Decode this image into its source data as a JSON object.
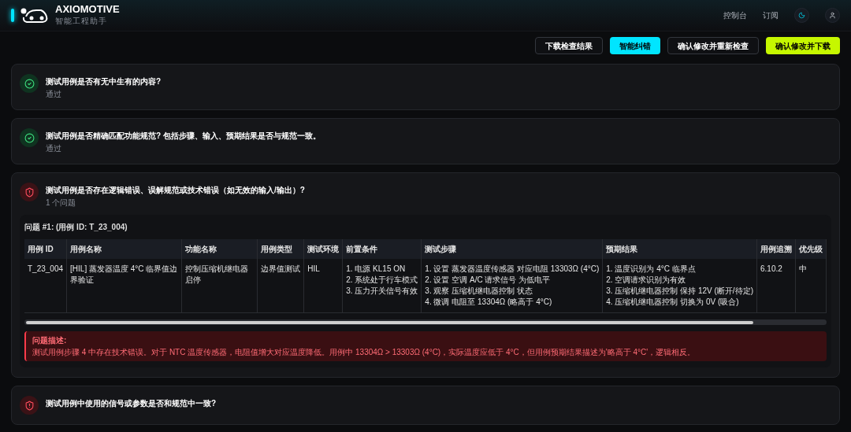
{
  "header": {
    "brand": "AXIOMOTIVE",
    "tagline": "智能工程助手",
    "nav": [
      "控制台",
      "订阅"
    ]
  },
  "actions": [
    {
      "label": "下载检查结果",
      "kind": "outline"
    },
    {
      "label": "智能纠错",
      "kind": "cyan"
    },
    {
      "label": "确认修改并重新检查",
      "kind": "outline"
    },
    {
      "label": "确认修改并下载",
      "kind": "lime"
    }
  ],
  "checks": [
    {
      "kind": "pass",
      "title": "测试用例是否有无中生有的内容?",
      "subtitle": "通过"
    },
    {
      "kind": "pass",
      "title": "测试用例是否精确匹配功能规范? 包括步骤、输入、预期结果是否与规范一致。",
      "subtitle": "通过"
    },
    {
      "kind": "issue",
      "title": "测试用例是否存在逻辑错误、误解规范或技术错误（如无效的输入/输出）?",
      "subtitle": "1 个问题",
      "issues": [
        {
          "heading": "问题 #1: (用例 ID: T_23_004)",
          "table": {
            "columns": [
              "用例 ID",
              "用例名称",
              "功能名称",
              "用例类型",
              "测试环境",
              "前置条件",
              "测试步骤",
              "预期结果",
              "用例追溯",
              "优先级"
            ],
            "rows": [
              [
                [
                  "T_23_004"
                ],
                [
                  "[HIL] 蒸发器温度 4°C 临界值边界验证"
                ],
                [
                  "控制压缩机继电器启停"
                ],
                [
                  "边界值测试"
                ],
                [
                  "HIL"
                ],
                [
                  "1. 电源 KL15 ON",
                  "2. 系统处于行车模式",
                  "3. 压力开关信号有效"
                ],
                [
                  "1. 设置 蒸发器温度传感器 对应电阻 13303Ω (4°C)",
                  "2. 设置 空调 A/C 请求信号 为低电平",
                  "3. 观察 压缩机继电器控制 状态",
                  "4. 微调 电阻至 13304Ω (略高于 4°C)"
                ],
                [
                  "1. 温度识别为 4°C 临界点",
                  "2. 空调请求识别为有效",
                  "3. 压缩机继电器控制 保持 12V (断开/待定)",
                  "4. 压缩机继电器控制 切换为 0V (吸合)"
                ],
                [
                  "6.10.2"
                ],
                [
                  "中"
                ]
              ]
            ]
          },
          "description_label": "问题描述:",
          "description": "测试用例步骤 4 中存在技术错误。对于 NTC 温度传感器，电阻值增大对应温度降低。用例中 13304Ω > 13303Ω (4°C)，实际温度应低于 4°C，但用例预期结果描述为'略高于 4°C'，逻辑相反。"
        }
      ]
    },
    {
      "kind": "issue",
      "title": "测试用例中使用的信号或参数是否和规范中一致?"
    }
  ]
}
